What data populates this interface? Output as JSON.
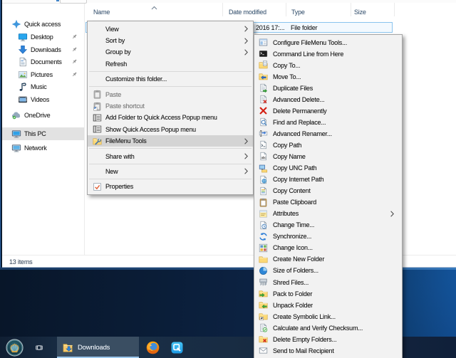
{
  "window": {
    "status_text": "13 items",
    "columns": [
      {
        "label": "Name"
      },
      {
        "label": "Date modified"
      },
      {
        "label": "Type"
      },
      {
        "label": "Size"
      }
    ],
    "selected_row": {
      "date_modified": "2016 17:...",
      "type": "File folder"
    },
    "sidebar": [
      {
        "label": "Quick access",
        "icon": "quick-access",
        "level": 0,
        "pin": false,
        "selected": false
      },
      {
        "label": "Desktop",
        "icon": "desktop",
        "level": 1,
        "pin": true,
        "selected": false
      },
      {
        "label": "Downloads",
        "icon": "downloads",
        "level": 1,
        "pin": true,
        "selected": false
      },
      {
        "label": "Documents",
        "icon": "documents",
        "level": 1,
        "pin": true,
        "selected": false
      },
      {
        "label": "Pictures",
        "icon": "pictures",
        "level": 1,
        "pin": true,
        "selected": false
      },
      {
        "label": "Music",
        "icon": "music",
        "level": 1,
        "pin": false,
        "selected": false
      },
      {
        "label": "Videos",
        "icon": "videos",
        "level": 1,
        "pin": false,
        "selected": false
      },
      {
        "label": "OneDrive",
        "icon": "onedrive",
        "level": 0,
        "pin": false,
        "selected": false
      },
      {
        "label": "This PC",
        "icon": "this-pc",
        "level": 0,
        "pin": false,
        "selected": true
      },
      {
        "label": "Network",
        "icon": "network",
        "level": 0,
        "pin": false,
        "selected": false
      }
    ]
  },
  "context_menu": {
    "items": [
      {
        "label": "View",
        "chevron": true
      },
      {
        "label": "Sort by",
        "chevron": true
      },
      {
        "label": "Group by",
        "chevron": true
      },
      {
        "label": "Refresh"
      },
      {
        "separator": true
      },
      {
        "label": "Customize this folder..."
      },
      {
        "separator": true
      },
      {
        "label": "Paste",
        "icon": "paste",
        "disabled": true
      },
      {
        "label": "Paste shortcut",
        "icon": "paste-shortcut",
        "disabled": true
      },
      {
        "label": "Add Folder to Quick Access Popup menu",
        "icon": "qap-menu"
      },
      {
        "label": "Show Quick Access Popup menu",
        "icon": "qap-menu"
      },
      {
        "label": "FileMenu Tools",
        "icon": "filemenu-tools",
        "chevron": true,
        "highlight": true
      },
      {
        "separator": true
      },
      {
        "label": "Share with",
        "chevron": true
      },
      {
        "separator": true
      },
      {
        "label": "New",
        "chevron": true
      },
      {
        "separator": true
      },
      {
        "label": "Properties",
        "icon": "properties"
      }
    ]
  },
  "submenu": {
    "items": [
      {
        "label": "Configure FileMenu Tools...",
        "icon": "configure"
      },
      {
        "label": "Command Line from Here",
        "icon": "cmd"
      },
      {
        "label": "Copy To...",
        "icon": "copy-to"
      },
      {
        "label": "Move To...",
        "icon": "move-to"
      },
      {
        "label": "Duplicate Files",
        "icon": "duplicate"
      },
      {
        "label": "Advanced Delete...",
        "icon": "adv-delete"
      },
      {
        "label": "Delete Permanently",
        "icon": "delete-perm"
      },
      {
        "label": "Find and Replace...",
        "icon": "find-replace"
      },
      {
        "label": "Advanced Renamer...",
        "icon": "adv-renamer"
      },
      {
        "label": "Copy Path",
        "icon": "copy-path"
      },
      {
        "label": "Copy Name",
        "icon": "copy-name"
      },
      {
        "label": "Copy UNC Path",
        "icon": "copy-unc"
      },
      {
        "label": "Copy Internet Path",
        "icon": "copy-inet"
      },
      {
        "label": "Copy Content",
        "icon": "copy-content"
      },
      {
        "label": "Paste Clipboard",
        "icon": "paste-clip"
      },
      {
        "label": "Attributes",
        "icon": "attributes",
        "chevron": true
      },
      {
        "label": "Change Time...",
        "icon": "change-time"
      },
      {
        "label": "Synchronize...",
        "icon": "synchronize"
      },
      {
        "label": "Change Icon...",
        "icon": "change-icon"
      },
      {
        "label": "Create New Folder",
        "icon": "new-folder"
      },
      {
        "label": "Size of Folders...",
        "icon": "size-folders"
      },
      {
        "label": "Shred Files...",
        "icon": "shred"
      },
      {
        "label": "Pack to Folder",
        "icon": "pack"
      },
      {
        "label": "Unpack Folder",
        "icon": "unpack"
      },
      {
        "label": "Create Symbolic Link...",
        "icon": "symlink"
      },
      {
        "label": "Calculate and Verify Checksum...",
        "icon": "checksum"
      },
      {
        "label": "Delete Empty Folders...",
        "icon": "del-empty"
      },
      {
        "label": "Send to Mail Recipient",
        "icon": "mail"
      }
    ]
  },
  "taskbar": {
    "buttons": [
      {
        "name": "start",
        "icon": "start-orb"
      },
      {
        "name": "task-view",
        "icon": "task-view"
      },
      {
        "name": "downloads-window",
        "icon": "folder-downloads",
        "label": "Downloads",
        "active": true
      },
      {
        "name": "firefox",
        "icon": "firefox"
      },
      {
        "name": "q-app",
        "icon": "q-app"
      }
    ]
  },
  "colors": {
    "menu_bg": "#f2f2f2",
    "menu_highlight": "#d4d4d4",
    "taskbar_bg": "#1f3246",
    "accent_blue": "#2f7cd6",
    "header_text": "#41607e"
  }
}
